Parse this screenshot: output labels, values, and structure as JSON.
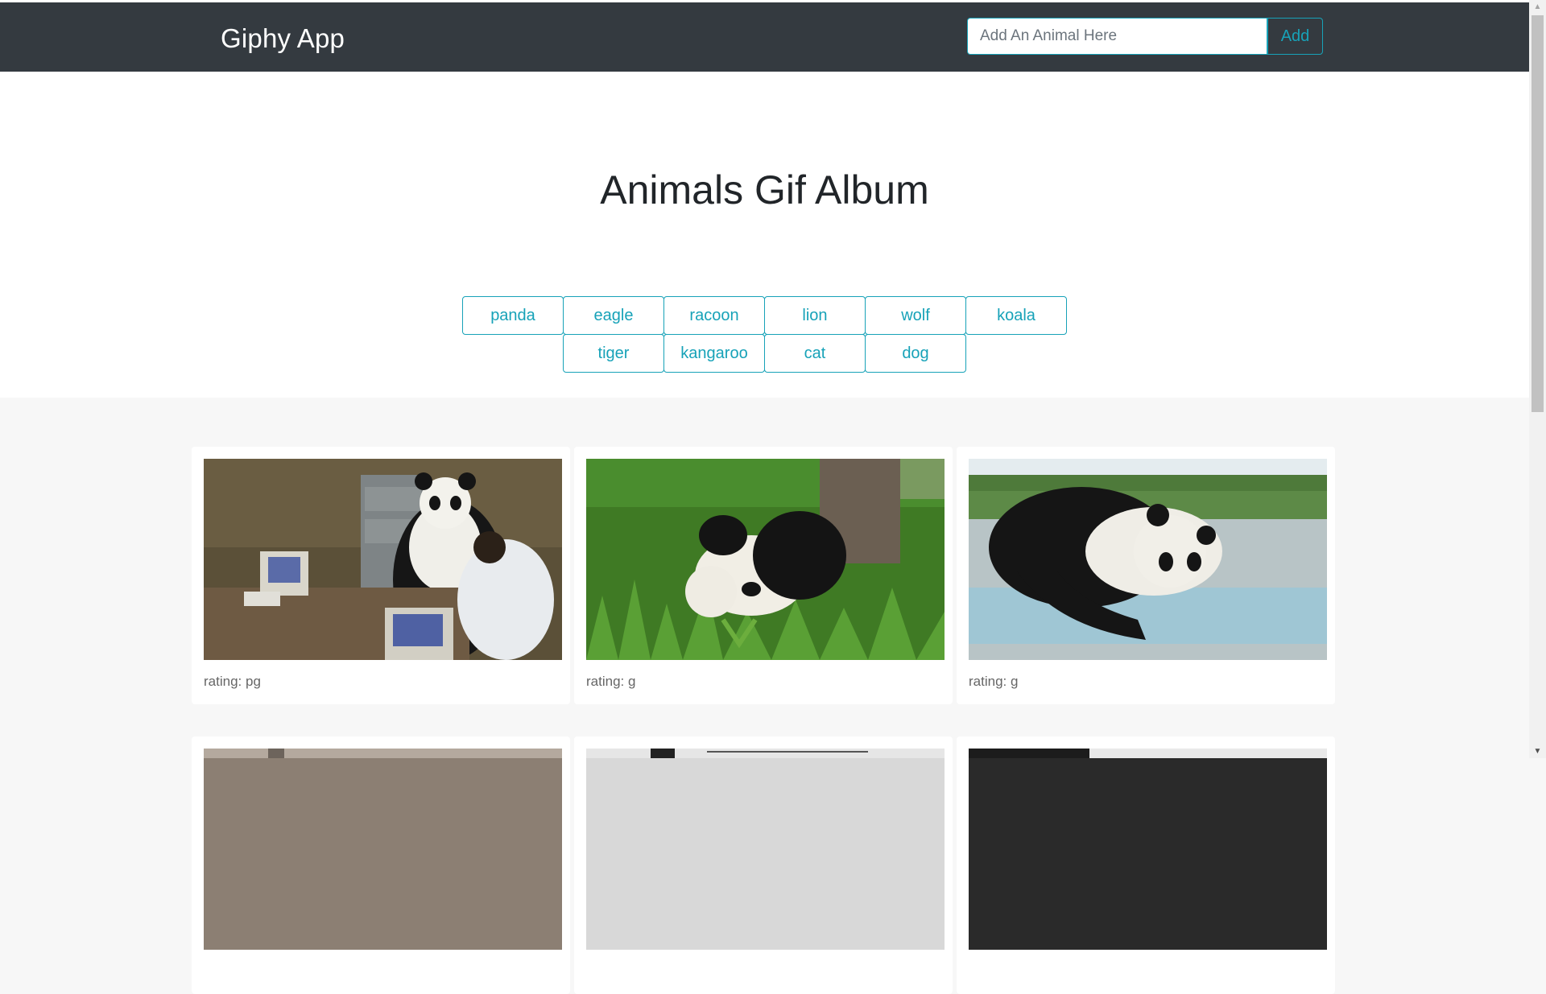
{
  "navbar": {
    "brand": "Giphy App",
    "search_placeholder": "Add An Animal Here",
    "add_label": "Add"
  },
  "hero": {
    "title": "Animals Gif Album"
  },
  "animal_buttons": [
    "panda",
    "eagle",
    "racoon",
    "lion",
    "wolf",
    "koala",
    "tiger",
    "kangaroo",
    "cat",
    "dog"
  ],
  "gifs": [
    {
      "rating_label": "rating:",
      "rating": "pg",
      "scene": "panda-costume-office"
    },
    {
      "rating_label": "rating:",
      "rating": "g",
      "scene": "panda-rolling-grass"
    },
    {
      "rating_label": "rating:",
      "rating": "g",
      "scene": "panda-stretching"
    }
  ],
  "colors": {
    "navbar": "#343a40",
    "accent": "#17a2b8",
    "page_bg": "#f7f7f7"
  }
}
